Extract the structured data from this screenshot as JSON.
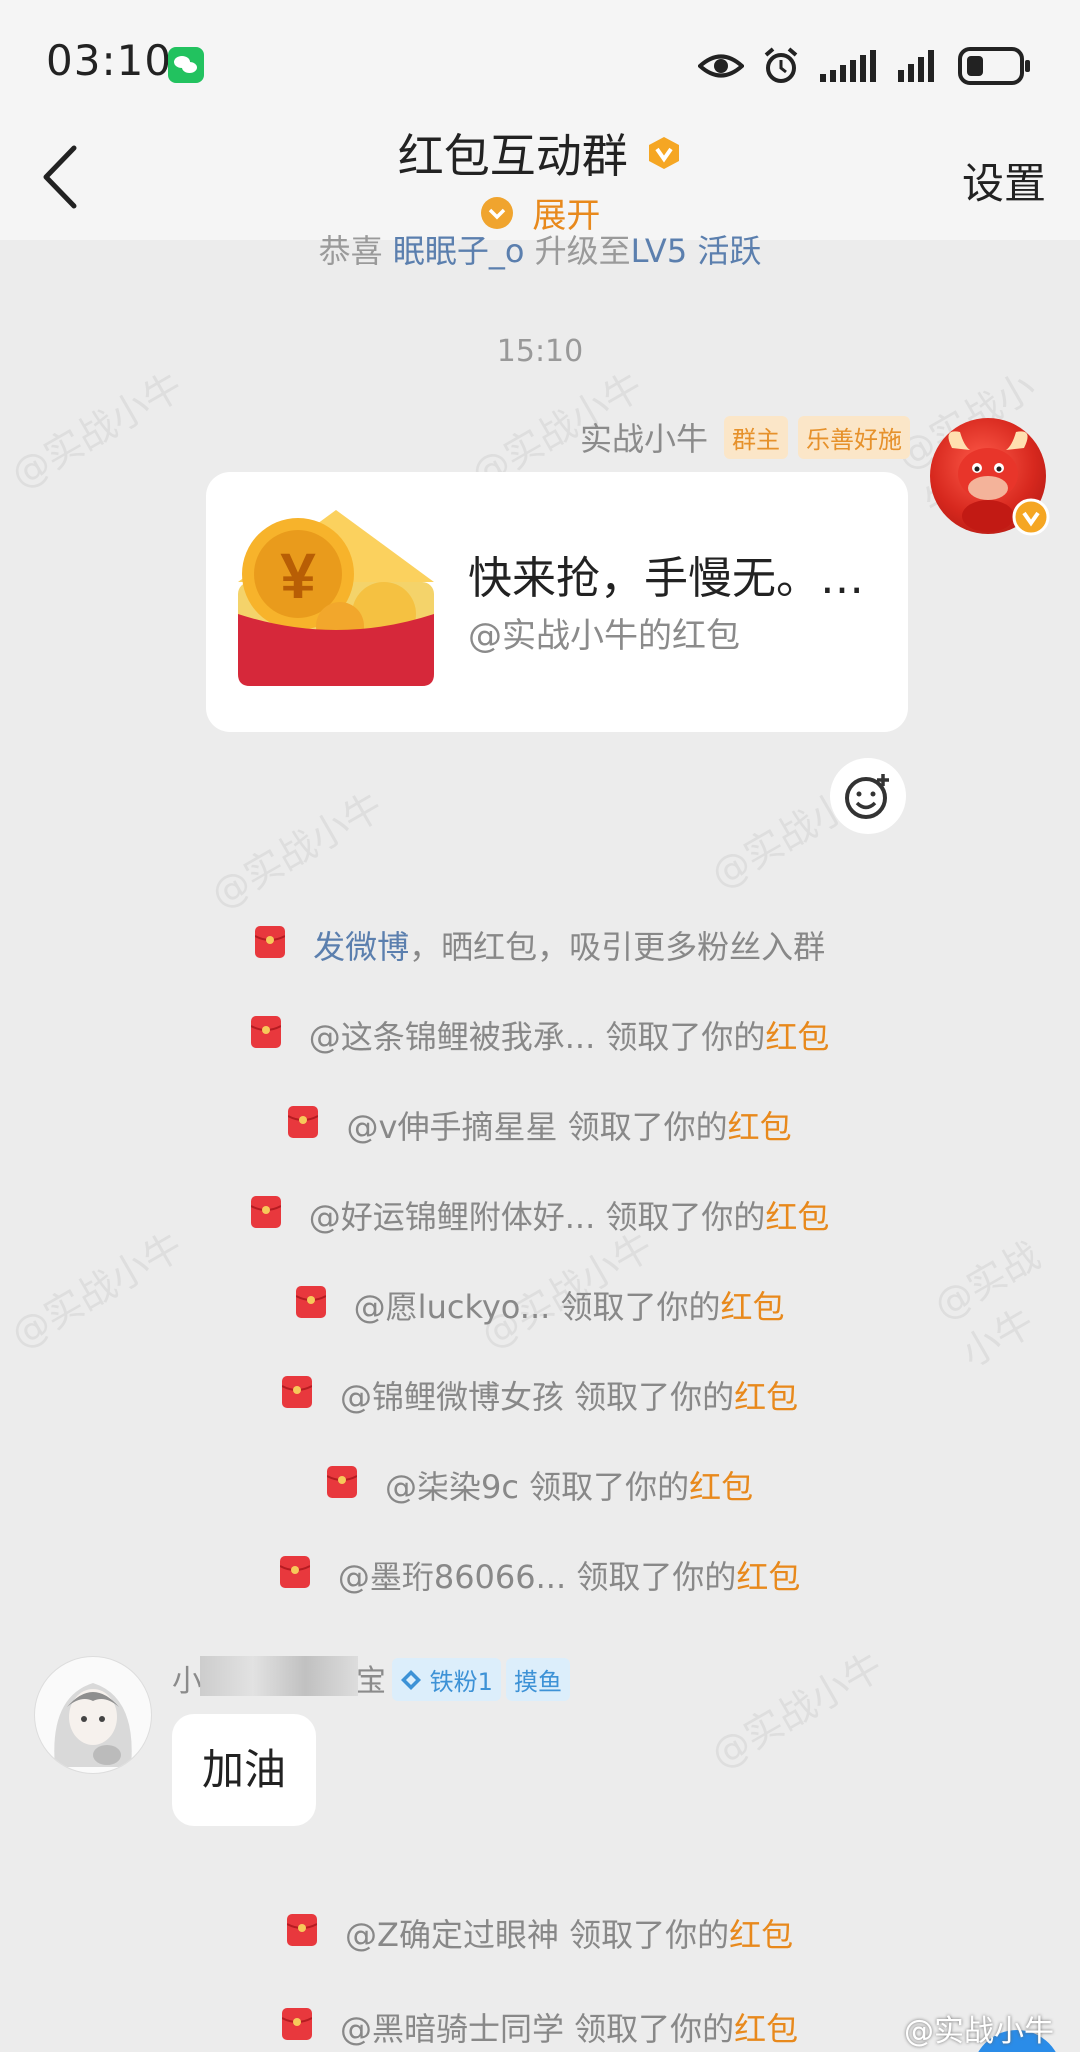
{
  "status_bar": {
    "time": "03:10"
  },
  "header": {
    "title": "红包互动群",
    "expand_label": "展开",
    "settings_label": "设置"
  },
  "notice_partial": {
    "prefix": "恭喜 ",
    "user": "眠眠子_o",
    "middle": " 升级至",
    "level": "LV5 活跃"
  },
  "timestamp": "15:10",
  "owner_message": {
    "sender": "实战小牛",
    "tags": [
      "群主",
      "乐善好施"
    ],
    "card_title": "快来抢，手慢无。…",
    "card_subtitle": "@实战小牛的红包"
  },
  "system_lines": [
    {
      "pre": "发微博",
      "text": "，晒红包，吸引更多粉丝入群",
      "hl": ""
    },
    {
      "pre": "",
      "text": "@这条锦鲤被我承... 领取了你的",
      "hl": "红包"
    },
    {
      "pre": "",
      "text": "@v伸手摘星星 领取了你的",
      "hl": "红包"
    },
    {
      "pre": "",
      "text": "@好运锦鲤附体好... 领取了你的",
      "hl": "红包"
    },
    {
      "pre": "",
      "text": "@愿luckyo... 领取了你的",
      "hl": "红包"
    },
    {
      "pre": "",
      "text": "@锦鲤微博女孩 领取了你的",
      "hl": "红包"
    },
    {
      "pre": "",
      "text": "@柒染9c 领取了你的",
      "hl": "红包"
    },
    {
      "pre": "",
      "text": "@墨珩86066... 领取了你的",
      "hl": "红包"
    },
    {
      "pre": "",
      "text": "@Z确定过眼神 领取了你的",
      "hl": "红包"
    },
    {
      "pre": "",
      "text": "@黑暗骑士同学 领取了你的",
      "hl": "红包"
    }
  ],
  "member_message": {
    "name_start": "小",
    "name_end": "宝",
    "tag_fan": "铁粉1",
    "tag_extra": "摸鱼",
    "text": "加油"
  },
  "watermark": "@实战小牛",
  "colors": {
    "accent": "#e8891c",
    "link": "#5b7fae",
    "red_packet": "#d6283a"
  }
}
